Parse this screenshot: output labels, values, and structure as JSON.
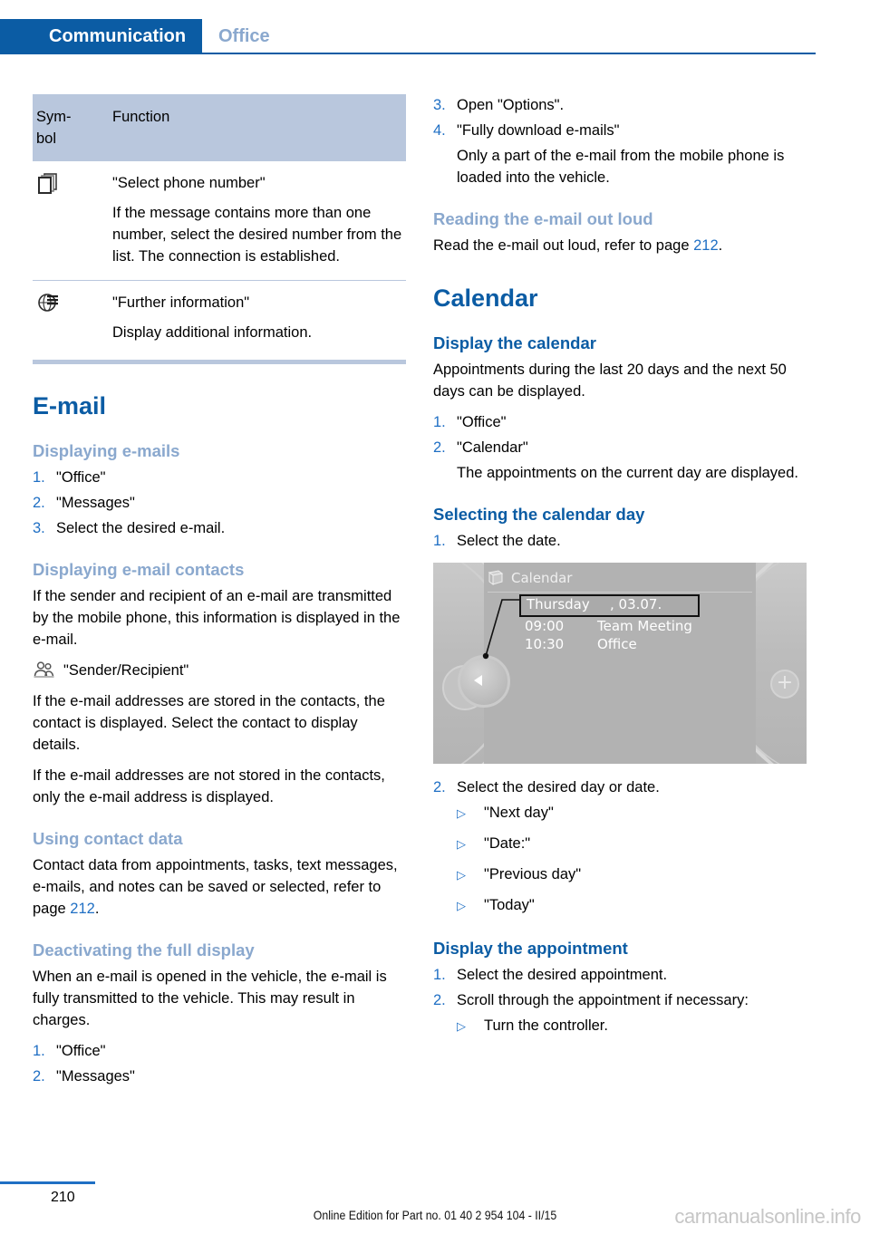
{
  "header": {
    "active_tab": "Communication",
    "inactive_tab": "Office"
  },
  "symbol_table": {
    "headers": {
      "symbol": "Sym-\nbol",
      "symbol_line1": "Sym-",
      "symbol_line2": "bol",
      "function": "Function"
    },
    "rows": [
      {
        "icon": "stacked-pages-icon",
        "title": "\"Select phone number\"",
        "description": "If the message contains more than one number, select the desired number from the list. The connection is established."
      },
      {
        "icon": "globe-info-icon",
        "title": "\"Further information\"",
        "description": "Display additional information."
      }
    ]
  },
  "left_column": {
    "email_heading": "E-mail",
    "displaying_emails": {
      "heading": "Displaying e-mails",
      "steps": [
        "\"Office\"",
        "\"Messages\"",
        "Select the desired e-mail."
      ]
    },
    "displaying_email_contacts": {
      "heading": "Displaying e-mail contacts",
      "para1": "If the sender and recipient of an e-mail are transmitted by the mobile phone, this information is displayed in the e-mail.",
      "icon": "people-icon",
      "icon_label": "\"Sender/Recipient\"",
      "para2": "If the e-mail addresses are stored in the contacts, the contact is displayed. Select the contact to display details.",
      "para3": "If the e-mail addresses are not stored in the contacts, only the e-mail address is displayed."
    },
    "using_contact_data": {
      "heading": "Using contact data",
      "para_before": "Contact data from appointments, tasks, text messages, e-mails, and notes can be saved or selected, refer to page ",
      "page_ref": "212",
      "para_after": "."
    },
    "deactivating_full_display": {
      "heading": "Deactivating the full display",
      "para": "When an e-mail is opened in the vehicle, the e-mail is fully transmitted to the vehicle. This may result in charges.",
      "steps": [
        "\"Office\"",
        "\"Messages\""
      ]
    }
  },
  "right_column": {
    "continued_steps": [
      {
        "num": "3.",
        "text": "Open \"Options\"."
      },
      {
        "num": "4.",
        "text": "\"Fully download e-mails\""
      }
    ],
    "step4_sub": "Only a part of the e-mail from the mobile phone is loaded into the vehicle.",
    "reading_out_loud": {
      "heading": "Reading the e-mail out loud",
      "para_before": "Read the e-mail out loud, refer to page ",
      "page_ref": "212",
      "para_after": "."
    },
    "calendar_heading": "Calendar",
    "display_the_calendar": {
      "heading": "Display the calendar",
      "para": "Appointments during the last 20 days and the next 50 days can be displayed.",
      "steps": [
        "\"Office\"",
        "\"Calendar\""
      ],
      "step2_sub": "The appointments on the current day are displayed."
    },
    "selecting_calendar_day": {
      "heading": "Selecting the calendar day",
      "step1": "Select the date.",
      "step2": "Select the desired day or date.",
      "options": [
        "\"Next day\"",
        "\"Date:\"",
        "\"Previous day\"",
        "\"Today\""
      ]
    },
    "display_the_appointment": {
      "heading": "Display the appointment",
      "step1": "Select the desired appointment.",
      "step2": "Scroll through the appointment if necessary:",
      "sub_option": "Turn the controller."
    }
  },
  "idrive_screenshot": {
    "title": "Calendar",
    "selected_day": "Thursday",
    "selected_date": ", 03.07.",
    "appointments": [
      {
        "time": "09:00",
        "name": "Team Meeting"
      },
      {
        "time": "10:30",
        "name": "Office"
      }
    ],
    "plus_label": "+"
  },
  "footer": {
    "page_number": "210",
    "edition_text": "Online Edition for Part no. 01 40 2 954 104 - II/15",
    "watermark": "carmanualsonline.info"
  },
  "colors": {
    "brand_blue": "#0b5ca4",
    "light_blue_heading": "#8aa8ce",
    "link_blue": "#1f6fc4",
    "table_header_bg": "#b9c7dd"
  }
}
